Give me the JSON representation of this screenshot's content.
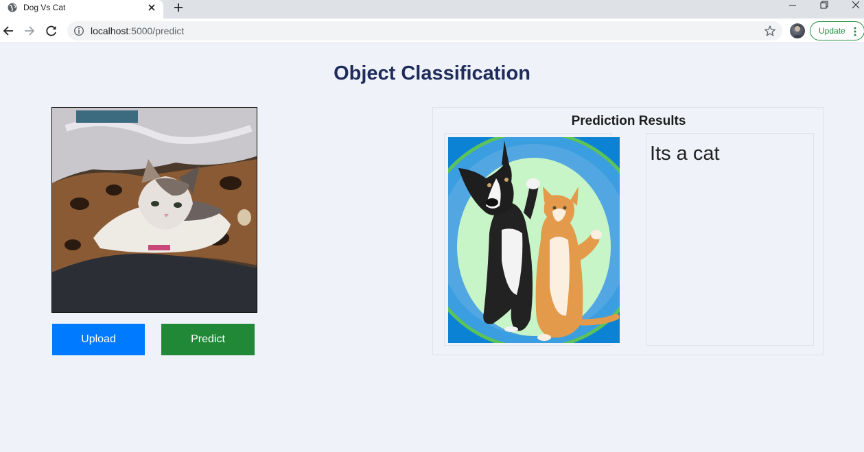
{
  "browser": {
    "tab_title": "Dog Vs Cat",
    "url_host": "localhost",
    "url_path": ":5000/predict",
    "update_label": "Update"
  },
  "page": {
    "title": "Object Classification",
    "upload_button": "Upload",
    "predict_button": "Predict",
    "results_title": "Prediction Results",
    "prediction_text": "Its a cat"
  },
  "colors": {
    "upload_button": "#007bff",
    "predict_button": "#218838",
    "title": "#1f2c5b",
    "background": "#eff2f9"
  },
  "icons": [
    "globe-icon",
    "close-icon",
    "plus-icon",
    "minimize-icon",
    "maximize-icon",
    "window-close-icon",
    "back-arrow-icon",
    "forward-arrow-icon",
    "reload-icon",
    "info-icon",
    "star-icon",
    "kebab-icon"
  ]
}
